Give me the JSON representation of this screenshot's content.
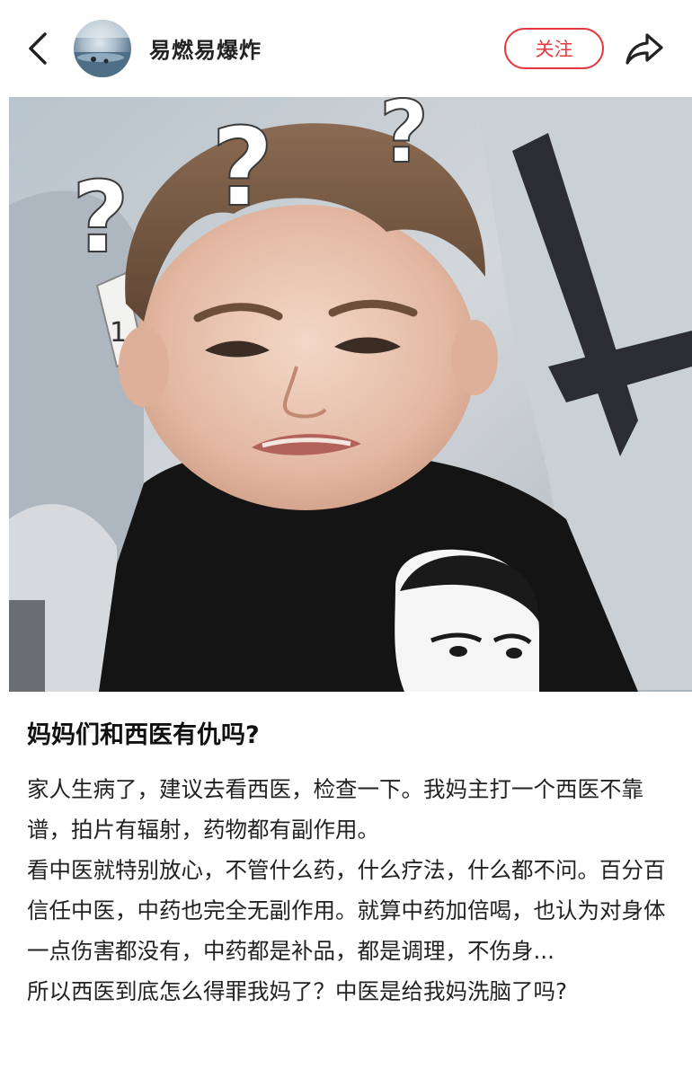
{
  "header": {
    "username": "易燃易爆炸",
    "follow_label": "关注",
    "back_icon": "chevron-left-icon",
    "share_icon": "share-arrow-icon"
  },
  "post": {
    "title": "妈妈们和西医有仇吗?",
    "paragraphs": [
      "家人生病了，建议去看西医，检查一下。我妈主打一个西医不靠谱，拍片有辐射，药物都有副作用。",
      "看中医就特别放心，不管什么药，什么疗法，什么都不问。百分百信任中医，中药也完全无副作用。就算中药加倍喝，也认为对身体一点伤害都没有，中药都是补品，都是调理，不伤身...",
      "所以西医到底怎么得罪我妈了？中医是给我妈洗脑了吗?"
    ]
  },
  "photo": {
    "overlay_glyphs": [
      "?",
      "?",
      "?"
    ],
    "seat_number": "1"
  },
  "colors": {
    "accent": "#e6393f",
    "text": "#222222"
  }
}
